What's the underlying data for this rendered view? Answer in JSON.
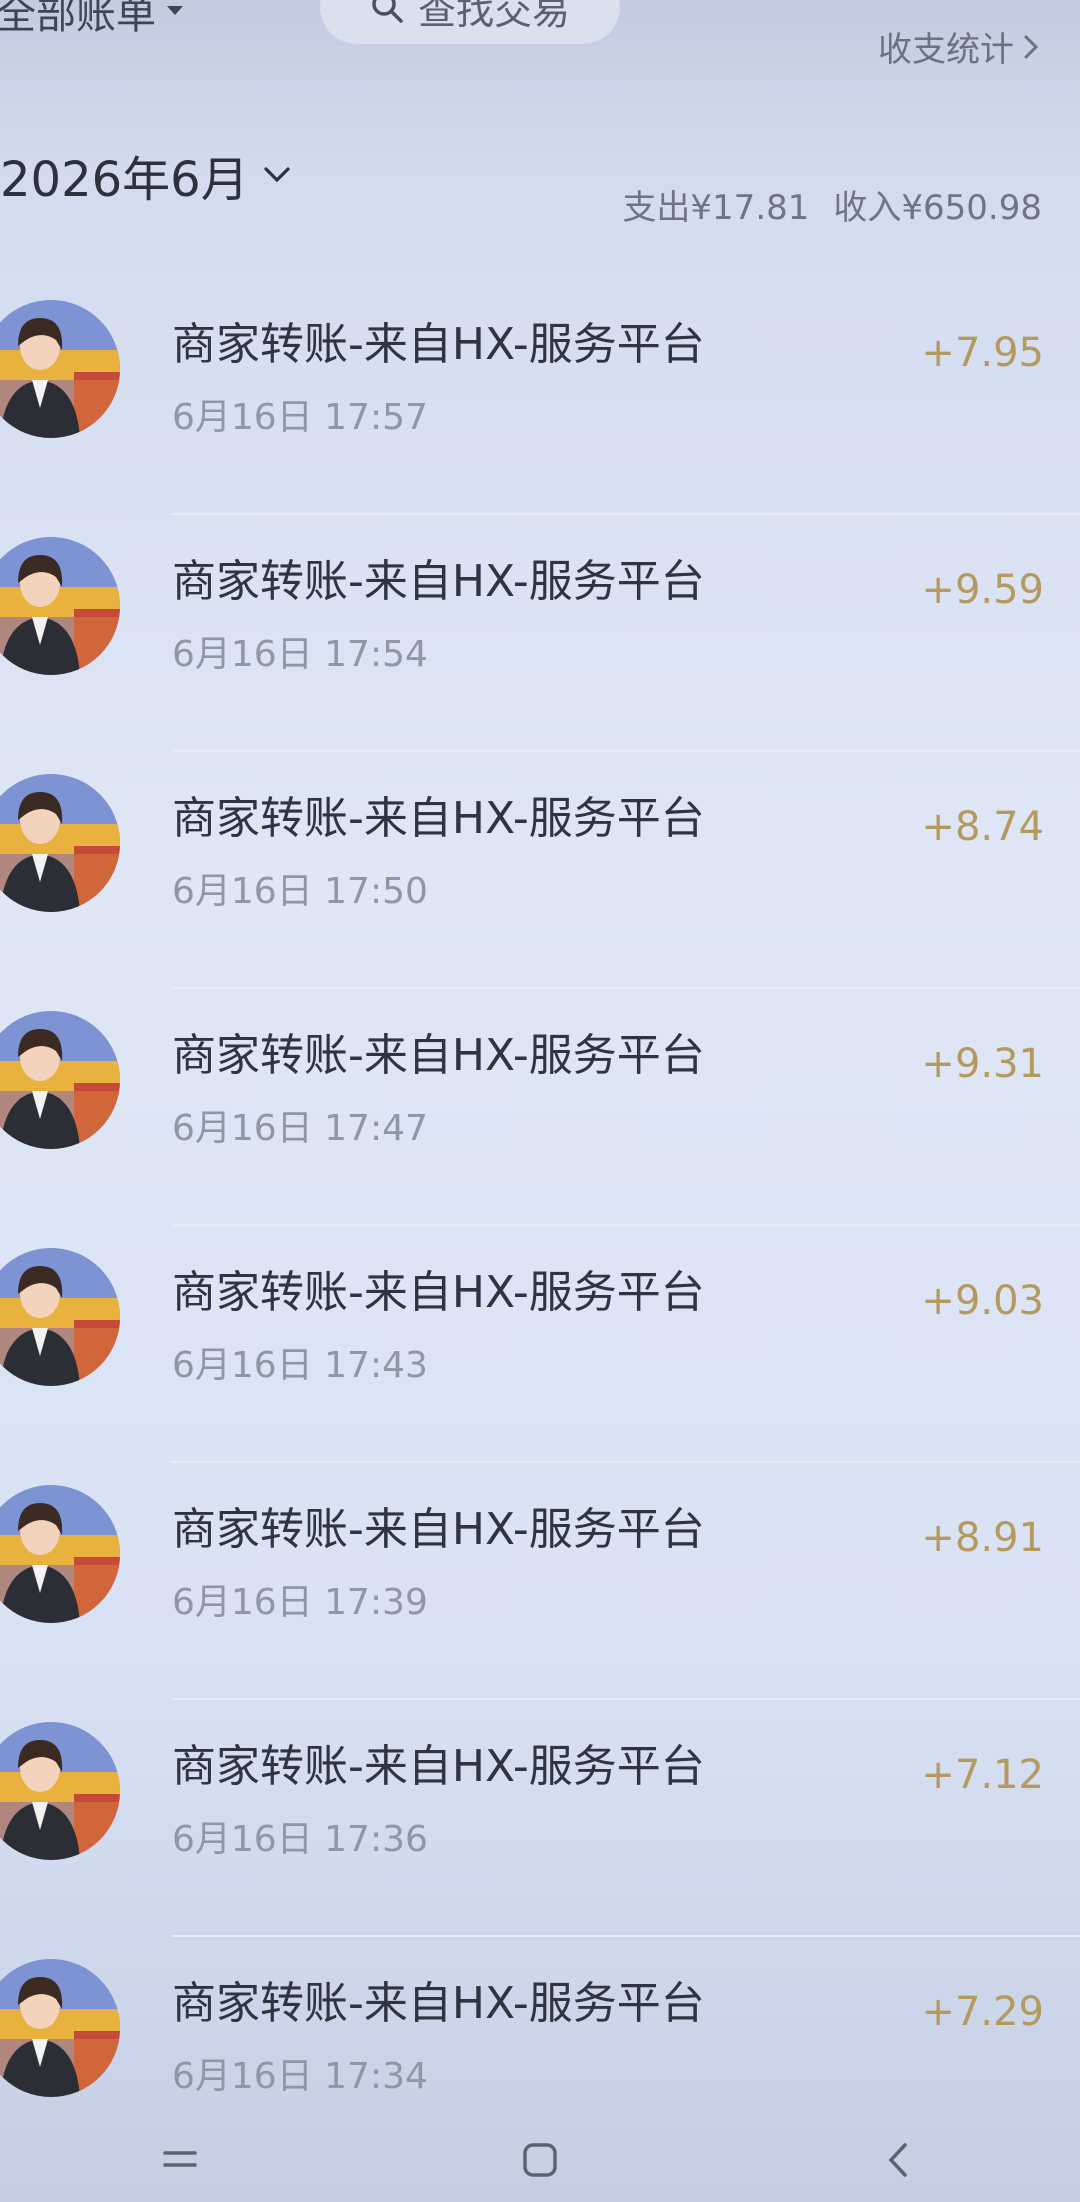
{
  "header": {
    "account_filter": "全部账单",
    "search_placeholder": "查找交易",
    "stats_link": "收支统计"
  },
  "month": {
    "label": "2026年6月",
    "expense": "支出¥17.81",
    "income": "收入¥650.98"
  },
  "transactions": [
    {
      "title": "商家转账-来自HX-服务平台",
      "time": "6月16日 17:57",
      "amount": "+7.95"
    },
    {
      "title": "商家转账-来自HX-服务平台",
      "time": "6月16日 17:54",
      "amount": "+9.59"
    },
    {
      "title": "商家转账-来自HX-服务平台",
      "time": "6月16日 17:50",
      "amount": "+8.74"
    },
    {
      "title": "商家转账-来自HX-服务平台",
      "time": "6月16日 17:47",
      "amount": "+9.31"
    },
    {
      "title": "商家转账-来自HX-服务平台",
      "time": "6月16日 17:43",
      "amount": "+9.03"
    },
    {
      "title": "商家转账-来自HX-服务平台",
      "time": "6月16日 17:39",
      "amount": "+8.91"
    },
    {
      "title": "商家转账-来自HX-服务平台",
      "time": "6月16日 17:36",
      "amount": "+7.12"
    },
    {
      "title": "商家转账-来自HX-服务平台",
      "time": "6月16日 17:34",
      "amount": "+7.29"
    }
  ],
  "icons": {
    "avatar": "business-woman-avatar",
    "nav": [
      "menu-icon",
      "home-icon",
      "back-icon"
    ]
  },
  "colors": {
    "amount": "#b59a5f",
    "title": "#2f3441",
    "muted": "#8f96a6"
  }
}
